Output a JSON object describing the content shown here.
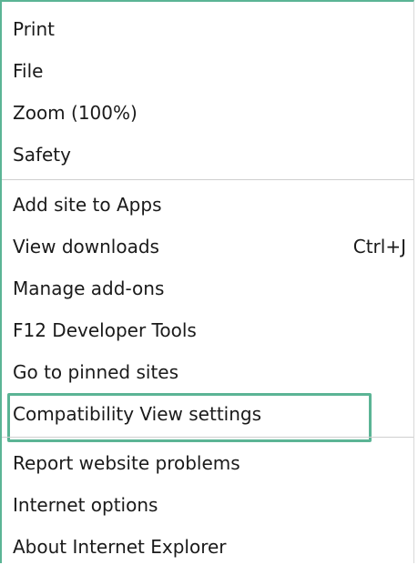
{
  "menu": {
    "items": [
      {
        "label": "Print",
        "shortcut": ""
      },
      {
        "label": "File",
        "shortcut": ""
      },
      {
        "label": "Zoom (100%)",
        "shortcut": ""
      },
      {
        "label": "Safety",
        "shortcut": ""
      },
      {
        "label": "Add site to Apps",
        "shortcut": ""
      },
      {
        "label": "View downloads",
        "shortcut": "Ctrl+J"
      },
      {
        "label": "Manage add-ons",
        "shortcut": ""
      },
      {
        "label": "F12 Developer Tools",
        "shortcut": ""
      },
      {
        "label": "Go to pinned sites",
        "shortcut": ""
      },
      {
        "label": "Compatibility View settings",
        "shortcut": ""
      },
      {
        "label": "Report website problems",
        "shortcut": ""
      },
      {
        "label": "Internet options",
        "shortcut": ""
      },
      {
        "label": "About Internet Explorer",
        "shortcut": ""
      }
    ],
    "highlighted_item": "Compatibility View settings",
    "highlight_color": "#5bb495"
  }
}
